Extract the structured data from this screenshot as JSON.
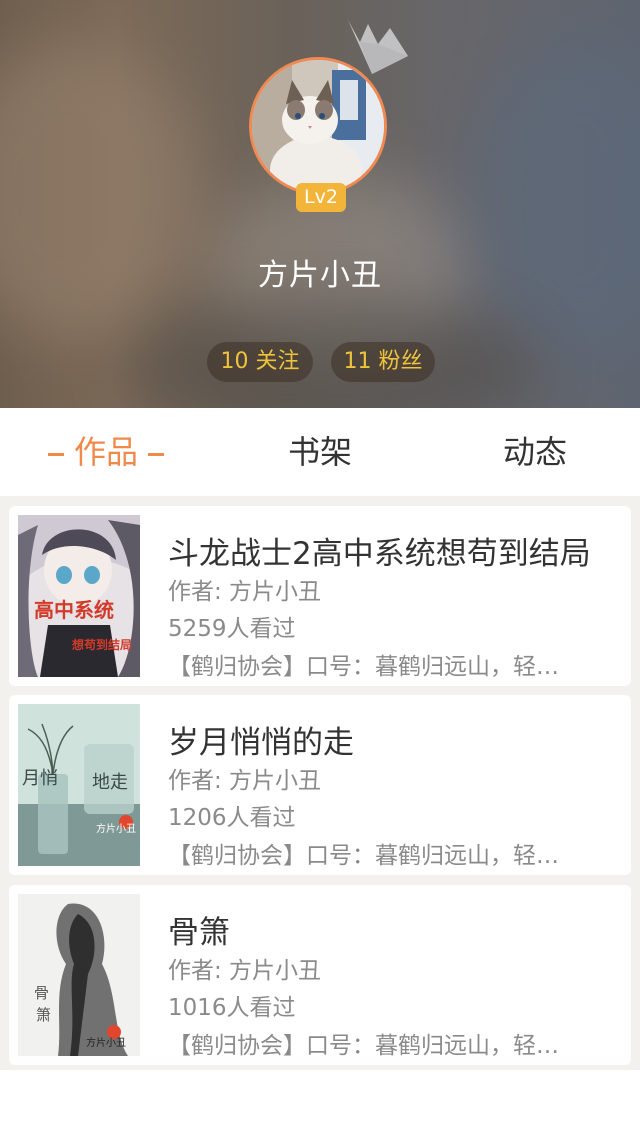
{
  "profile": {
    "level": "Lv2",
    "username": "方片小丑",
    "following": "10 关注",
    "fans": "11 粉丝"
  },
  "tabs": [
    {
      "label": "作品",
      "active": true
    },
    {
      "label": "书架",
      "active": false
    },
    {
      "label": "动态",
      "active": false
    }
  ],
  "books": [
    {
      "title": "斗龙战士2高中系统想苟到结局",
      "author": "作者: 方片小丑",
      "views": "5259人看过",
      "desc": "【鹤归协会】口号：暮鹤归远山，轻…",
      "cover_text": [
        "高中系统",
        "想苟到结局"
      ]
    },
    {
      "title": "岁月悄悄的走",
      "author": "作者: 方片小丑",
      "views": "1206人看过",
      "desc": "【鹤归协会】口号：暮鹤归远山，轻…",
      "cover_text": [
        "月悄",
        "地走",
        "方片小丑"
      ]
    },
    {
      "title": "骨箫",
      "author": "作者: 方片小丑",
      "views": "1016人看过",
      "desc": "【鹤归协会】口号：暮鹤归远山，轻…",
      "cover_text": [
        "骨",
        "箫",
        "方片小丑"
      ]
    }
  ],
  "colors": {
    "accent": "#f08a4b",
    "stat_text": "#f0c33c",
    "badge": "#f2b53a"
  }
}
